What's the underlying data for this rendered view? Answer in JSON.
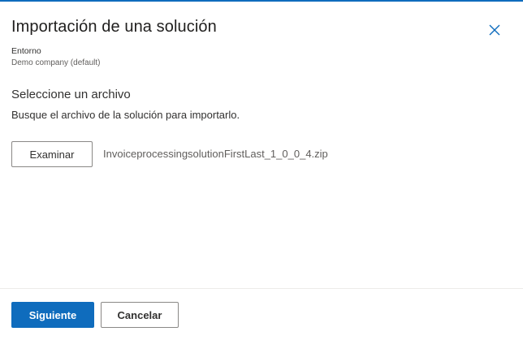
{
  "dialog": {
    "title": "Importación de una solución",
    "close_icon": "close-icon"
  },
  "environment": {
    "label": "Entorno",
    "value": "Demo company (default)"
  },
  "file_section": {
    "title": "Seleccione un archivo",
    "description": "Busque el archivo de la solución para importarlo.",
    "browse_label": "Examinar",
    "file_name": "InvoiceprocessingsolutionFirstLast_1_0_0_4.zip"
  },
  "footer": {
    "next_label": "Siguiente",
    "cancel_label": "Cancelar"
  },
  "colors": {
    "accent": "#0f6cbd",
    "text": "#323130",
    "muted": "#605e5c",
    "divider": "#edebe9"
  }
}
